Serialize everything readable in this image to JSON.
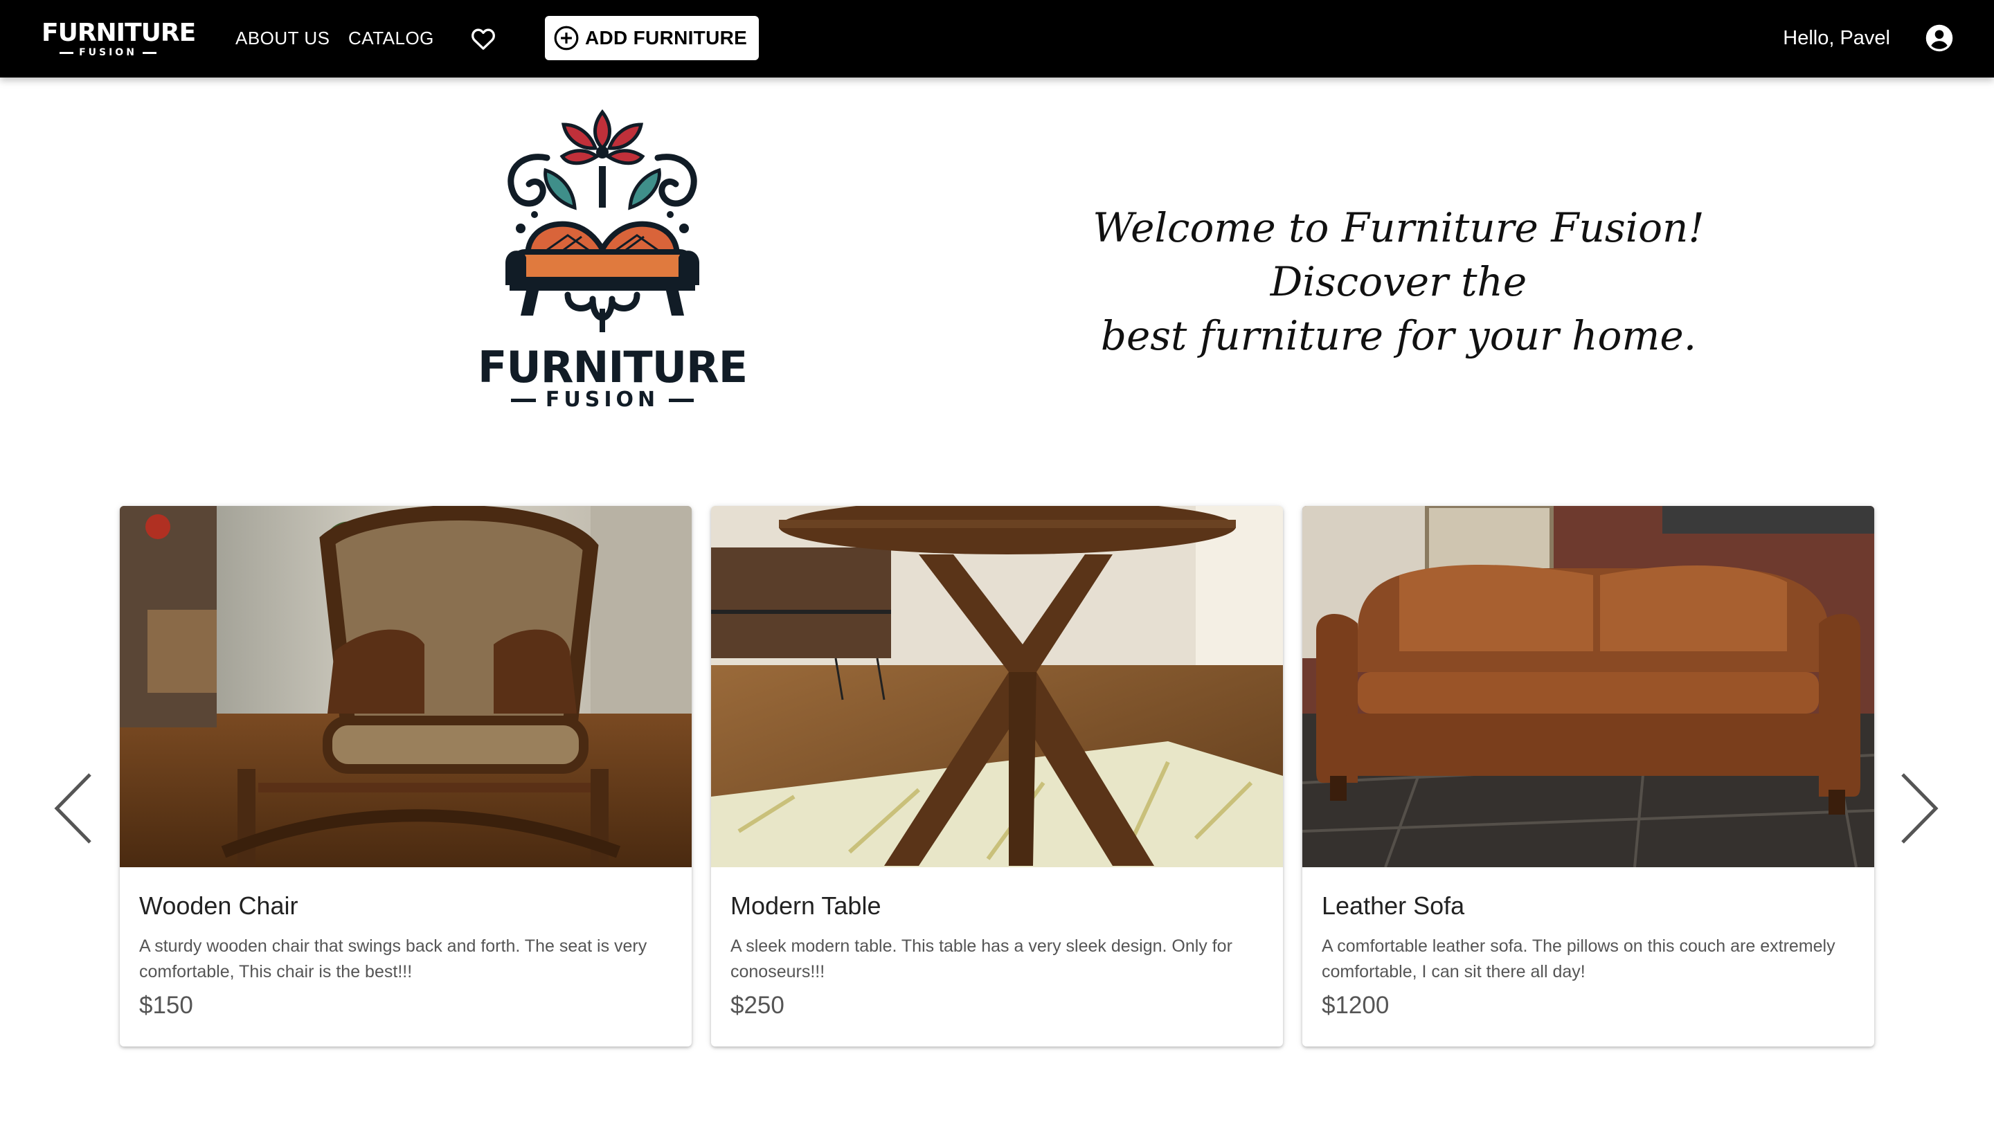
{
  "navbar": {
    "brand_title": "FURNITURE",
    "brand_subtitle": "FUSION",
    "links": [
      "ABOUT US",
      "CATALOG"
    ],
    "add_button_label": "ADD FURNITURE",
    "greeting": "Hello, Pavel",
    "icons": [
      "heart-icon",
      "plus-circle-icon",
      "account-circle-icon"
    ]
  },
  "hero": {
    "logo_title": "FURNITURE",
    "logo_subtitle": "FUSION",
    "welcome_line1": "Welcome to Furniture Fusion! Discover the",
    "welcome_line2": "best furniture for your home."
  },
  "carousel": {
    "icons": [
      "chevron-left-icon",
      "chevron-right-icon"
    ],
    "items": [
      {
        "title": "Wooden Chair",
        "description": "A sturdy wooden chair that swings back and forth. The seat is very comfortable, This chair is the best!!!",
        "price": "$150"
      },
      {
        "title": "Modern Table",
        "description": "A sleek modern table. This table has a very sleek design. Only for conoseurs!!!",
        "price": "$250"
      },
      {
        "title": "Leather Sofa",
        "description": "A comfortable leather sofa. The pillows on this couch are extremely comfortable, I can sit there all day!",
        "price": "$1200"
      }
    ]
  },
  "colors": {
    "navbar_bg": "#000000",
    "logo_dark": "#111c26",
    "logo_red": "#c0303a",
    "logo_teal": "#3f8f8a",
    "logo_orange": "#d9643a",
    "text_muted": "#555555"
  }
}
